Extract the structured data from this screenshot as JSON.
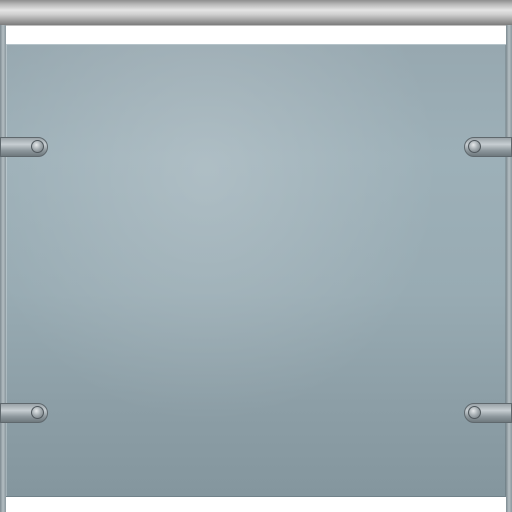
{
  "scene": {
    "subject": "glass-railing-panel",
    "colors": {
      "glass": "#98abb3",
      "handrail": "#cfcfcf",
      "clamp": "#9aa3a8",
      "background": "#ffffff"
    },
    "clamp_count": 4
  }
}
